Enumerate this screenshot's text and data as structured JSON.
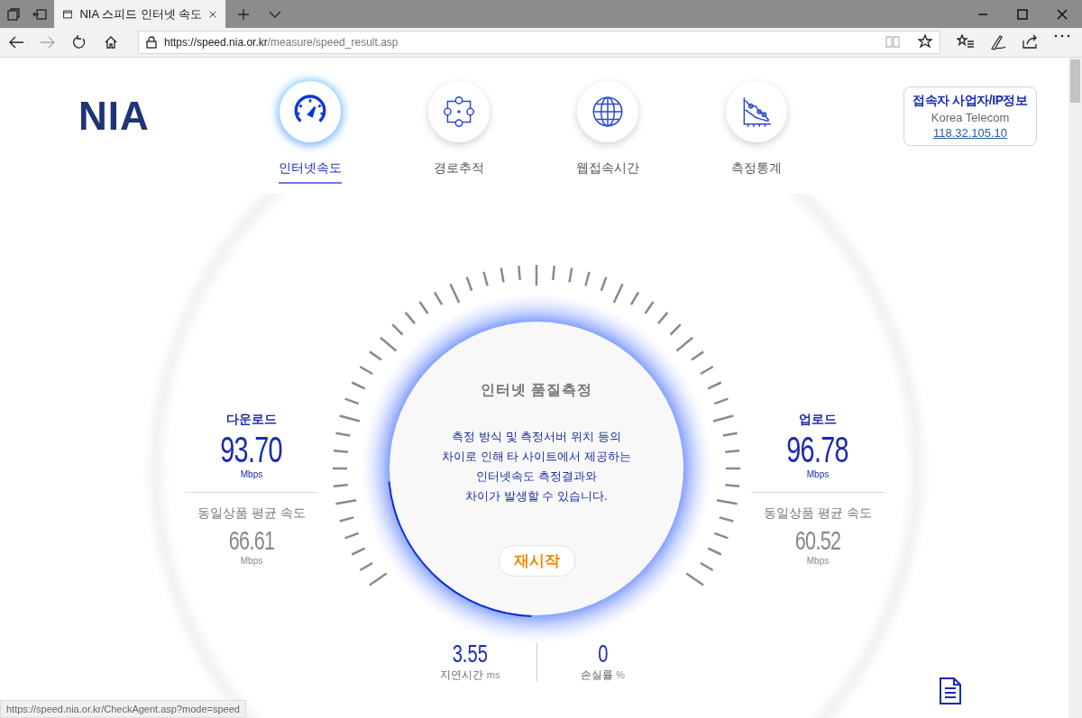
{
  "browser": {
    "tabs": [
      {
        "title": "NIA 스피드 인터넷 속도",
        "selected": true
      }
    ],
    "url_host": "https://speed.nia.or.kr",
    "url_path": "/measure/speed_result.asp",
    "status_url": "https://speed.nia.or.kr/CheckAgent.asp?mode=speed"
  },
  "site": {
    "logo": "NIA",
    "nav": [
      {
        "label": "인터넷속도",
        "selected": true
      },
      {
        "label": "경로추적",
        "selected": false
      },
      {
        "label": "웹접속시간",
        "selected": false
      },
      {
        "label": "측정통계",
        "selected": false
      }
    ],
    "isp": {
      "title": "접속자 사업자/IP정보",
      "provider": "Korea Telecom",
      "ip": "118.32.105.10"
    }
  },
  "gauge": {
    "title": "인터넷 품질측정",
    "message": "측정 방식 및 측정서버 위치 등의\n차이로 인해 타 사이트에서 제공하는\n인터넷속도 측정결과와\n차이가 발생할 수 있습니다.",
    "button": "재시작"
  },
  "download": {
    "label": "다운로드",
    "value": "93.70",
    "unit": "Mbps",
    "avg_label": "동일상품 평균 속도",
    "avg_value": "66.61",
    "avg_unit": "Mbps"
  },
  "upload": {
    "label": "업로드",
    "value": "96.78",
    "unit": "Mbps",
    "avg_label": "동일상품 평균 속도",
    "avg_value": "60.52",
    "avg_unit": "Mbps"
  },
  "metrics": [
    {
      "value": "3.55",
      "label": "지연시간",
      "unit": "ms"
    },
    {
      "value": "0",
      "label": "손실률",
      "unit": "%"
    }
  ]
}
